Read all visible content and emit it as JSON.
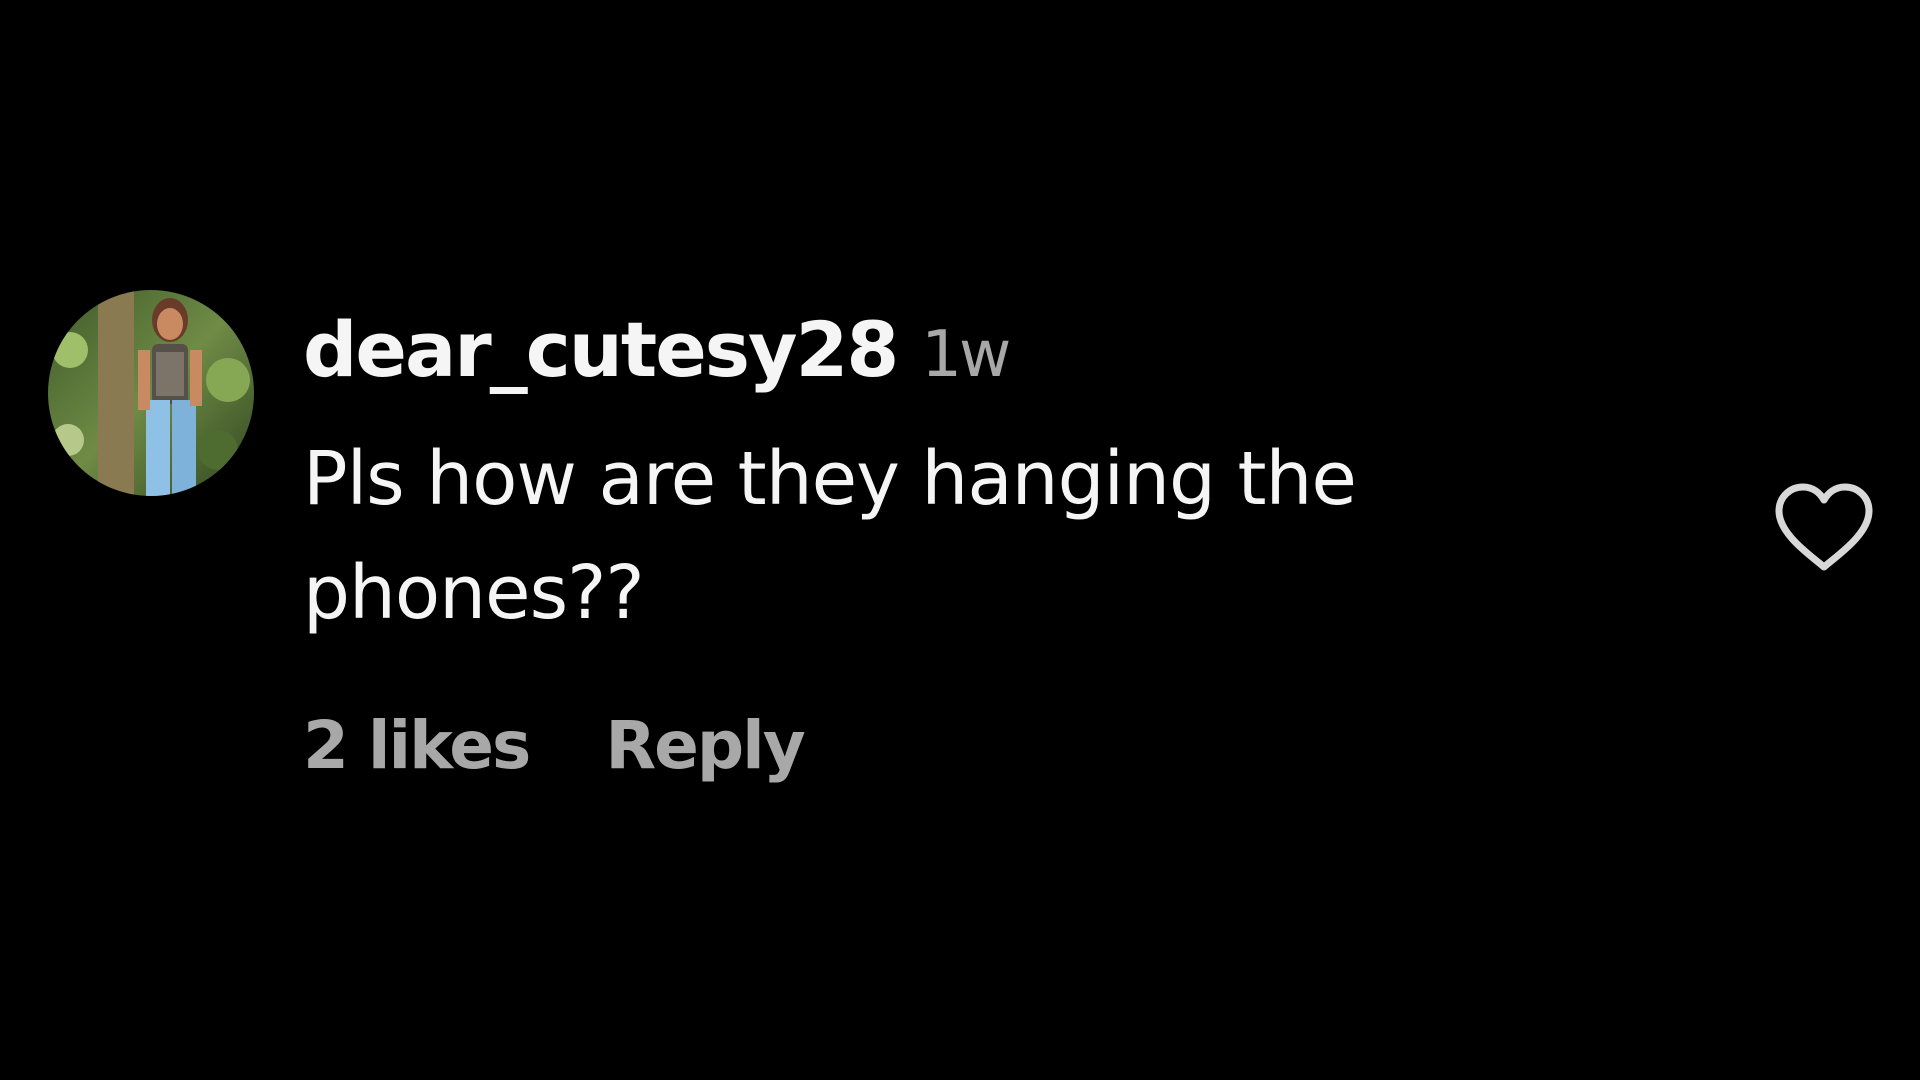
{
  "comment": {
    "username": "dear_cutesy28",
    "timestamp": "1w",
    "text": "Pls how are they hanging the phones??",
    "likes_label": "2 likes",
    "reply_label": "Reply"
  },
  "icons": {
    "like": "heart-outline-icon",
    "avatar": "user-avatar-photo"
  },
  "colors": {
    "background": "#000000",
    "primary_text": "#f5f5f5",
    "secondary_text": "#a8a8a8",
    "icon_stroke": "#d8d8d8"
  }
}
